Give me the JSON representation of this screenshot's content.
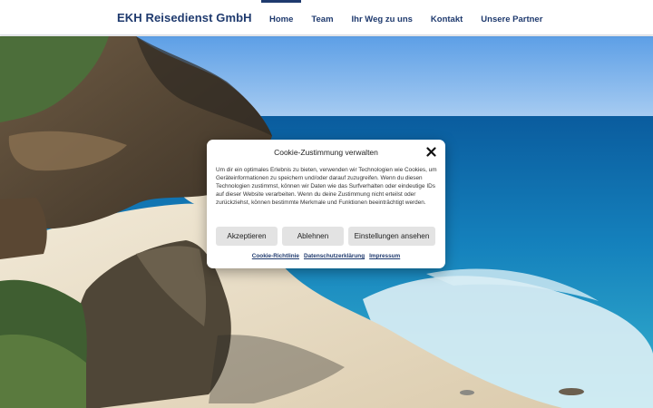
{
  "header": {
    "brand": "EKH Reisedienst GmbH",
    "nav": [
      "Home",
      "Team",
      "Ihr Weg zu uns",
      "Kontakt",
      "Unsere Partner"
    ],
    "active_nav": "Home"
  },
  "cookie_modal": {
    "title": "Cookie-Zustimmung verwalten",
    "body": "Um dir ein optimales Erlebnis zu bieten, verwenden wir Technologien wie Cookies, um Geräteinformationen zu speichern und/oder darauf zuzugreifen. Wenn du diesen Technologien zustimmst, können wir Daten wie das Surfverhalten oder eindeutige IDs auf dieser Website verarbeiten. Wenn du deine Zustimmung nicht erteilst oder zurückziehst, können bestimmte Merkmale und Funktionen beeinträchtigt werden.",
    "buttons": {
      "accept": "Akzeptieren",
      "deny": "Ablehnen",
      "settings": "Einstellungen ansehen"
    },
    "links": [
      "Cookie-Richtlinie",
      "Datenschutzerklärung",
      "Impressum"
    ]
  },
  "colors": {
    "brand": "#1f3a6e",
    "button_bg": "#e3e3e3",
    "modal_bg": "#ffffff"
  },
  "icons": {
    "close": "close-icon"
  }
}
